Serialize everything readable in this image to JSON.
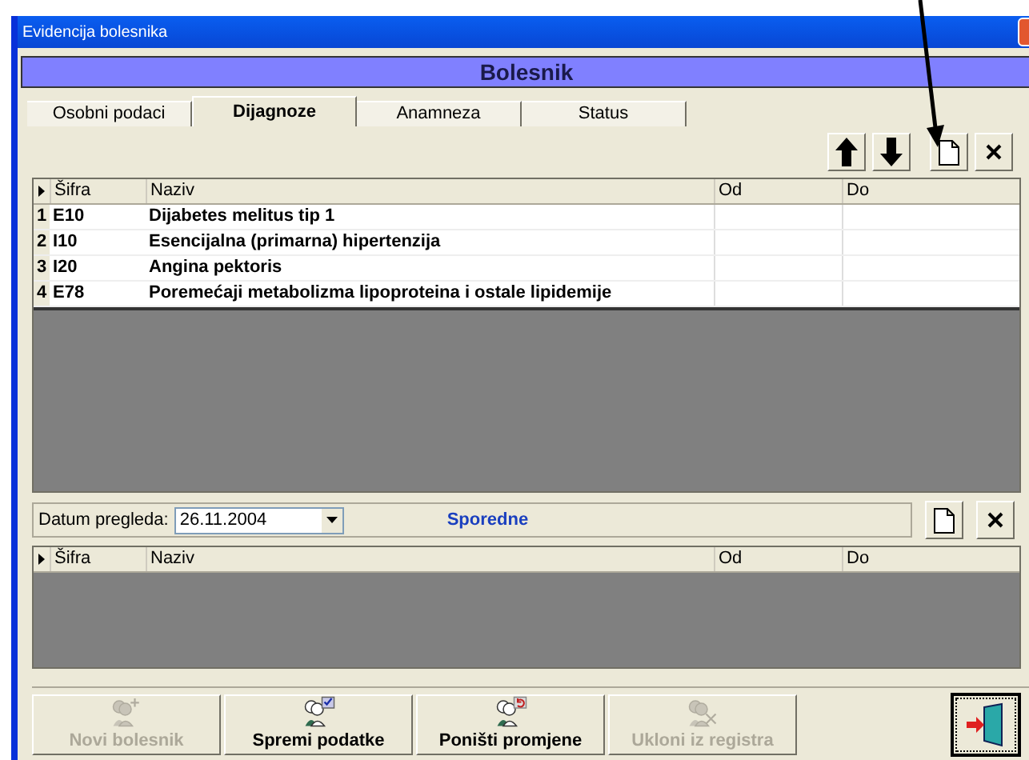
{
  "window": {
    "title": "Evidencija bolesnika"
  },
  "header": "Bolesnik",
  "tabs": [
    {
      "label": "Osobni podaci",
      "selected": false
    },
    {
      "label": "Dijagnoze",
      "selected": true
    },
    {
      "label": "Anamneza",
      "selected": false
    },
    {
      "label": "Status",
      "selected": false
    }
  ],
  "main_table": {
    "columns": [
      "Šifra",
      "Naziv",
      "Od",
      "Do"
    ],
    "rows": [
      {
        "index": "1",
        "code": "E10",
        "name": "Dijabetes melitus tip 1"
      },
      {
        "index": "2",
        "code": "I10",
        "name": "Esencijalna (primarna) hipertenzija"
      },
      {
        "index": "3",
        "code": "I20",
        "name": "Angina pektoris"
      },
      {
        "index": "4",
        "code": "E78",
        "name": "Poremećaji metabolizma lipoproteina i ostale lipidemije"
      }
    ]
  },
  "exam": {
    "label": "Datum pregleda:",
    "date": "26.11.2004",
    "section": "Sporedne"
  },
  "secondary_table": {
    "columns": [
      "Šifra",
      "Naziv",
      "Od",
      "Do"
    ]
  },
  "buttons": [
    {
      "label": "Novi bolesnik",
      "disabled": true,
      "kind": "add"
    },
    {
      "label": "Spremi podatke",
      "disabled": false,
      "kind": "save"
    },
    {
      "label": "Poništi promjene",
      "disabled": false,
      "kind": "undo"
    },
    {
      "label": "Ukloni iz registra",
      "disabled": true,
      "kind": "remove"
    }
  ]
}
